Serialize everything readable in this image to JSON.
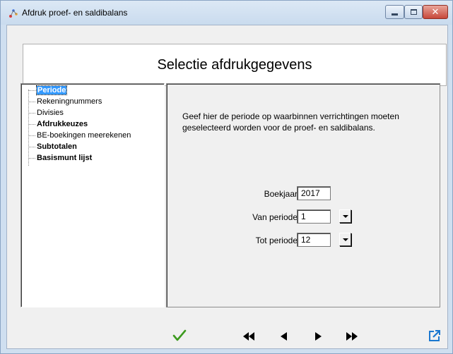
{
  "window": {
    "title": "Afdruk proef- en saldibalans"
  },
  "header": {
    "title": "Selectie afdrukgegevens"
  },
  "tree": {
    "items": [
      {
        "label": "Periode",
        "style": "selected"
      },
      {
        "label": "Rekeningnummers",
        "style": "normal"
      },
      {
        "label": "Divisies",
        "style": "normal"
      },
      {
        "label": "Afdrukkeuzes",
        "style": "bold"
      },
      {
        "label": "BE-boekingen meerekenen",
        "style": "normal"
      },
      {
        "label": "Subtotalen",
        "style": "bold"
      },
      {
        "label": "Basismunt lijst",
        "style": "bold"
      }
    ]
  },
  "content": {
    "info": "Geef hier de periode op waarbinnen verrichtingen moeten geselecteerd worden voor de proef- en saldibalans.",
    "boekjaar": {
      "label": "Boekjaar",
      "value": "2017"
    },
    "van_periode": {
      "label": "Van periode",
      "value": "1"
    },
    "tot_periode": {
      "label": "Tot periode",
      "value": "12"
    }
  },
  "toolbar": {
    "icons": [
      "checkmark-icon",
      "first-record-icon",
      "previous-record-icon",
      "next-record-icon",
      "last-record-icon",
      "export-icon"
    ],
    "colors": {
      "confirm": "#3c9a1e",
      "export": "#1b78d0",
      "nav": "#000000"
    }
  }
}
